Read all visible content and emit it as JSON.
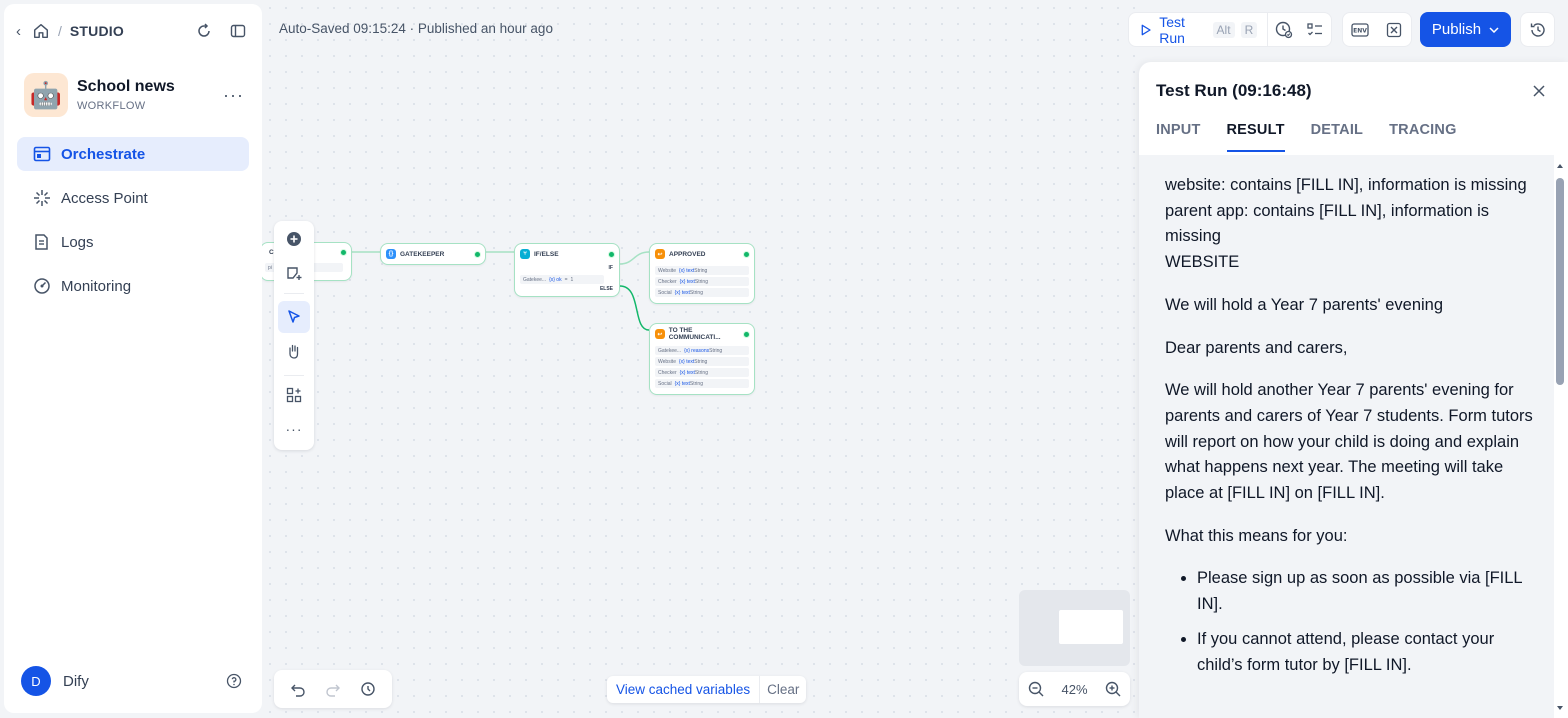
{
  "breadcrumb": {
    "section": "STUDIO"
  },
  "app": {
    "name": "School news",
    "type": "WORKFLOW",
    "icon": "robot-emoji",
    "emoji": "🤖"
  },
  "nav": {
    "items": [
      {
        "label": "Orchestrate",
        "icon": "orchestrate-icon",
        "active": true
      },
      {
        "label": "Access Point",
        "icon": "access-point-icon"
      },
      {
        "label": "Logs",
        "icon": "logs-icon"
      },
      {
        "label": "Monitoring",
        "icon": "monitoring-icon"
      }
    ]
  },
  "user": {
    "initial": "D",
    "name": "Dify"
  },
  "canvas": {
    "status": "Auto-Saved 09:15:24 · Published an hour ago",
    "zoom": "42%",
    "cached_label": "View cached variables",
    "clear_label": "Clear",
    "nodes": {
      "first": {
        "title": "CH...",
        "row": "pi"
      },
      "gatekeeper": {
        "title": "GATEKEEPER"
      },
      "ifelse": {
        "title": "IF/ELSE",
        "if": "IF",
        "cond_var": "Gatekee...",
        "cond_field": "{x} ok",
        "cond_op": "=",
        "cond_val": "1",
        "else": "ELSE"
      },
      "approved": {
        "title": "APPROVED",
        "rows": [
          {
            "src": "Website",
            "var": "{x} text",
            "type": "String"
          },
          {
            "src": "Checker",
            "var": "{x} text",
            "type": "String"
          },
          {
            "src": "Social",
            "var": "{x} text",
            "type": "String"
          }
        ]
      },
      "comms": {
        "title": "TO THE COMMUNICATI...",
        "rows": [
          {
            "src": "Gatekee...",
            "var": "{x} reasons",
            "type": "String"
          },
          {
            "src": "Website",
            "var": "{x} text",
            "type": "String"
          },
          {
            "src": "Checker",
            "var": "{x} text",
            "type": "String"
          },
          {
            "src": "Social",
            "var": "{x} text",
            "type": "String"
          }
        ]
      }
    }
  },
  "header": {
    "test_run_label": "Test Run",
    "kbd_alt": "Alt",
    "kbd_r": "R",
    "publish_label": "Publish"
  },
  "panel": {
    "title": "Test Run (09:16:48)",
    "tabs": [
      "INPUT",
      "RESULT",
      "DETAIL",
      "TRACING"
    ],
    "active_tab": "RESULT",
    "result": {
      "line1": "website: contains [FILL IN], information is missing",
      "line2": "parent app: contains [FILL IN], information is missing",
      "line3": "WEBSITE",
      "p1": "We will hold a Year 7 parents' evening",
      "p2": "Dear parents and carers,",
      "p3": "We will hold another Year 7 parents' evening for parents and carers of Year 7 students. Form tutors will report on how your child is doing and explain what happens next year. The meeting will take place at [FILL IN] on [FILL IN].",
      "p4": "What this means for you:",
      "bullets": [
        "Please sign up as soon as possible via [FILL IN].",
        "If you cannot attend, please contact your child’s form tutor by [FILL IN]."
      ]
    }
  },
  "colors": {
    "accent": "#1554e6",
    "success": "#12b76a",
    "node_border": "#a6e2c4"
  }
}
